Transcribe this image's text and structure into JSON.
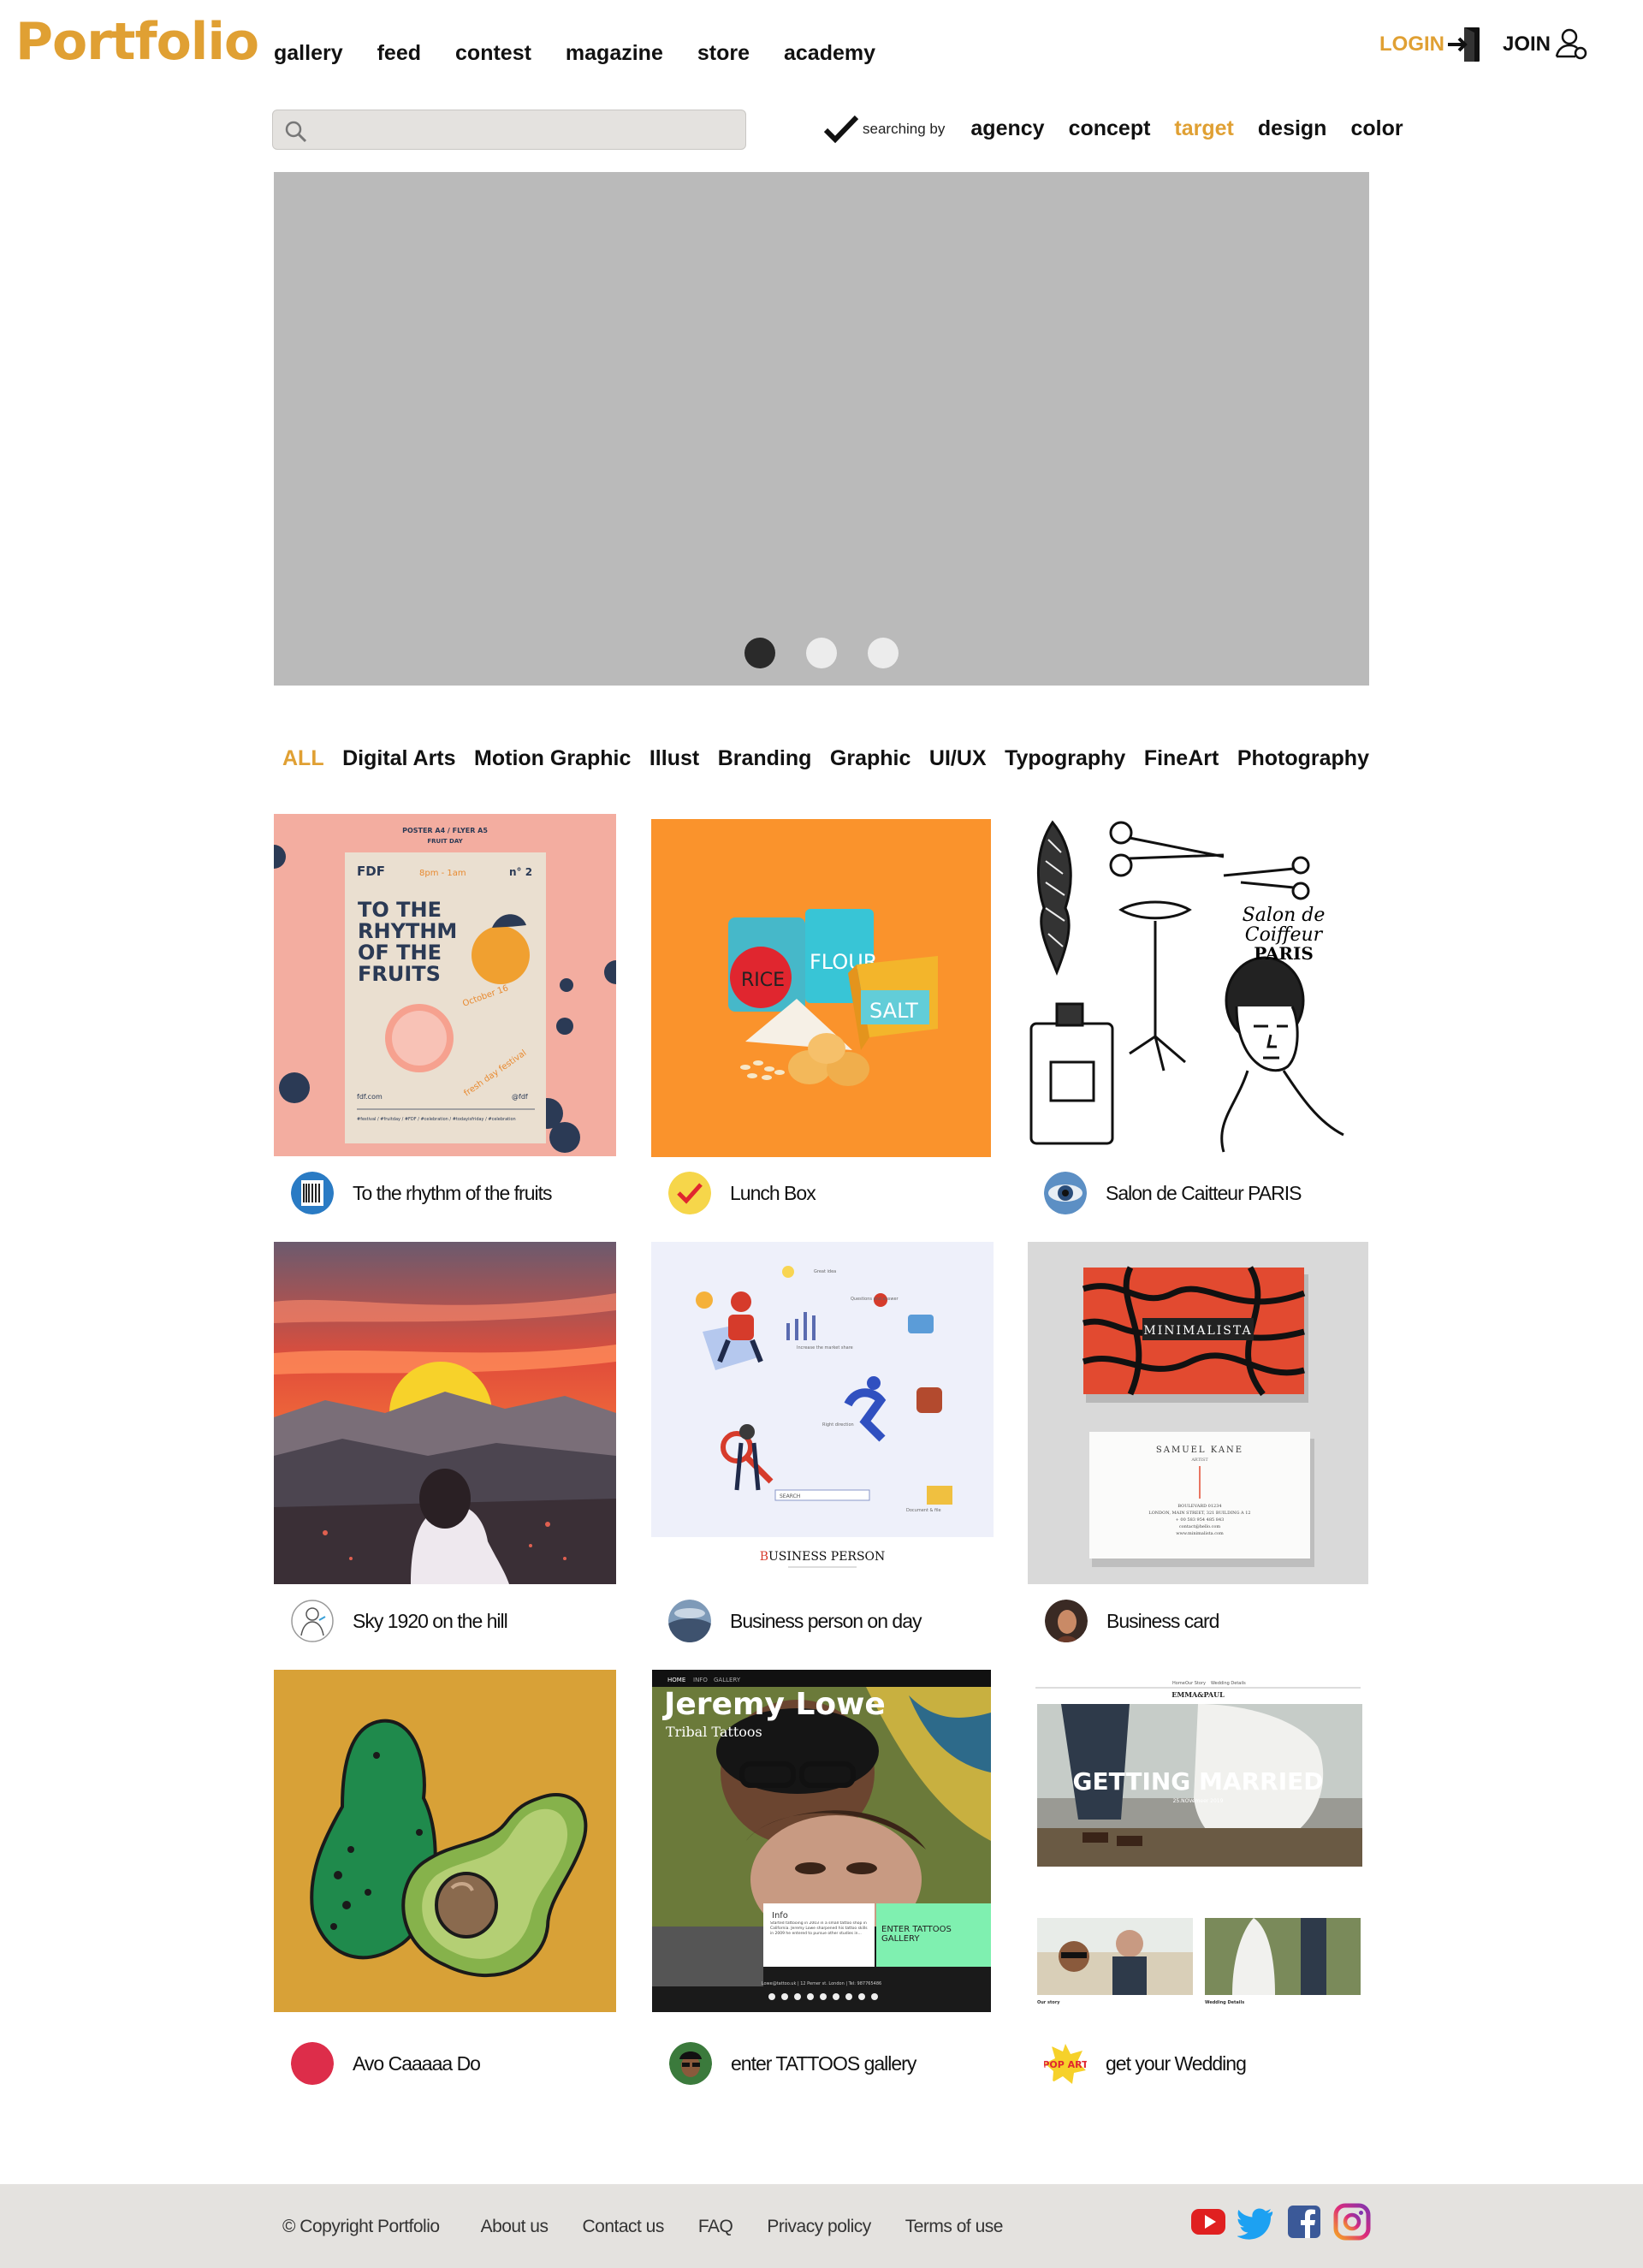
{
  "brand": {
    "logo": "Portfolio",
    "accent": "#e0a033"
  },
  "nav": [
    "gallery",
    "feed",
    "contest",
    "magazine",
    "store",
    "academy"
  ],
  "auth": {
    "login": "LOGIN",
    "join": "JOIN"
  },
  "search": {
    "value": "",
    "placeholder": "",
    "searching_by": "searching by",
    "options": [
      "agency",
      "concept",
      "target",
      "design",
      "color"
    ],
    "active_option": "target"
  },
  "carousel": {
    "slides": 3,
    "active": 1
  },
  "categories": {
    "items": [
      "ALL",
      "Digital Arts",
      "Motion Graphic",
      "Illust",
      "Branding",
      "Graphic",
      "UI/UX",
      "Typography",
      "FineArt",
      "Photography"
    ],
    "active": "ALL"
  },
  "cards": [
    {
      "title": "To the rhythm of the fruits",
      "art": {
        "poster_top": "POSTER A4 / FLYER A5",
        "poster_sub": "FRUIT DAY",
        "brand": "FDF",
        "time": "8pm - 1am",
        "num": "n° 2",
        "headline": [
          "TO THE",
          "RHYTHM",
          "OF THE",
          "FRUITS"
        ],
        "date": "October 16",
        "script": "fresh day festival",
        "url": "fdf.com",
        "handle": "@fdf",
        "tags": "#festival / #fruitday / #FDF / #celebration / #todayisfriday / #celebration"
      }
    },
    {
      "title": "Lunch Box",
      "art": {
        "rice": "RICE",
        "flour": "FLOUR",
        "salt": "SALT"
      }
    },
    {
      "title": "Salon de Caitteur PARIS",
      "art": {
        "script": [
          "Salon de",
          "Coiffeur"
        ],
        "city": "PARIS"
      }
    },
    {
      "title": "Sky 1920 on the hill",
      "art": {}
    },
    {
      "title": "Business person on day",
      "art": {
        "caption_first": "B",
        "caption_rest": "USINESS PERSON",
        "search": "SEARCH",
        "labels": [
          "Great idea",
          "Questions and answer",
          "Increase the market share",
          "Right direction",
          "Document & file"
        ]
      }
    },
    {
      "title": "Business card",
      "art": {
        "front": "MINIMALISTA",
        "name": "SAMUEL KANE",
        "role": "ARTIST",
        "address": [
          "BOULEVARD 01234",
          "LONDON, MAIN STREET, 321 BUILDING A 12",
          "+ 00 583 954 485 843",
          "contact@hello.com",
          "www.minimalista.com"
        ]
      }
    },
    {
      "title": "Avo Caaaaa Do",
      "art": {}
    },
    {
      "title": "enter TATTOOS gallery",
      "art": {
        "menu": [
          "HOME",
          "INFO",
          "GALLERY"
        ],
        "name": "Jeremy Lowe",
        "sub": "Tribal Tattoos",
        "info_title": "Info",
        "info_text": "Started tattooing in 2003 in a small tattoo shop in California. Jeremy Lowe sharpened his tattoo skills in 2009 he entered to pursue other studies in...",
        "cta": "ENTER TATTOOS GALLERY",
        "footer": "Lowe@tattoo.uk | 12 Pemer st. London | Tel: 987765486"
      }
    },
    {
      "title": "get your Wedding",
      "art": {
        "menu": [
          "Home",
          "Our Story",
          "Wedding Details"
        ],
        "couple": "EMMA&PAUL",
        "headline": "GETTING MARRIED",
        "date": "25.NOVemeer 2019",
        "cap_left": "Our story",
        "cap_right": "Wedding Details",
        "avatar_text": "POP ART"
      }
    }
  ],
  "footer": {
    "copyright": "© Copyright Portfolio",
    "links": [
      "About us",
      "Contact us",
      "FAQ",
      "Privacy policy",
      "Terms of use"
    ],
    "social": [
      "youtube-icon",
      "twitter-icon",
      "facebook-icon",
      "instagram-icon"
    ]
  },
  "colors": {
    "youtube": "#e02020",
    "twitter": "#1da1f2",
    "facebook": "#3b5998",
    "instagram": "#c13584",
    "carousel_bg": "#bababa",
    "footer_bg": "#e4e2df"
  }
}
